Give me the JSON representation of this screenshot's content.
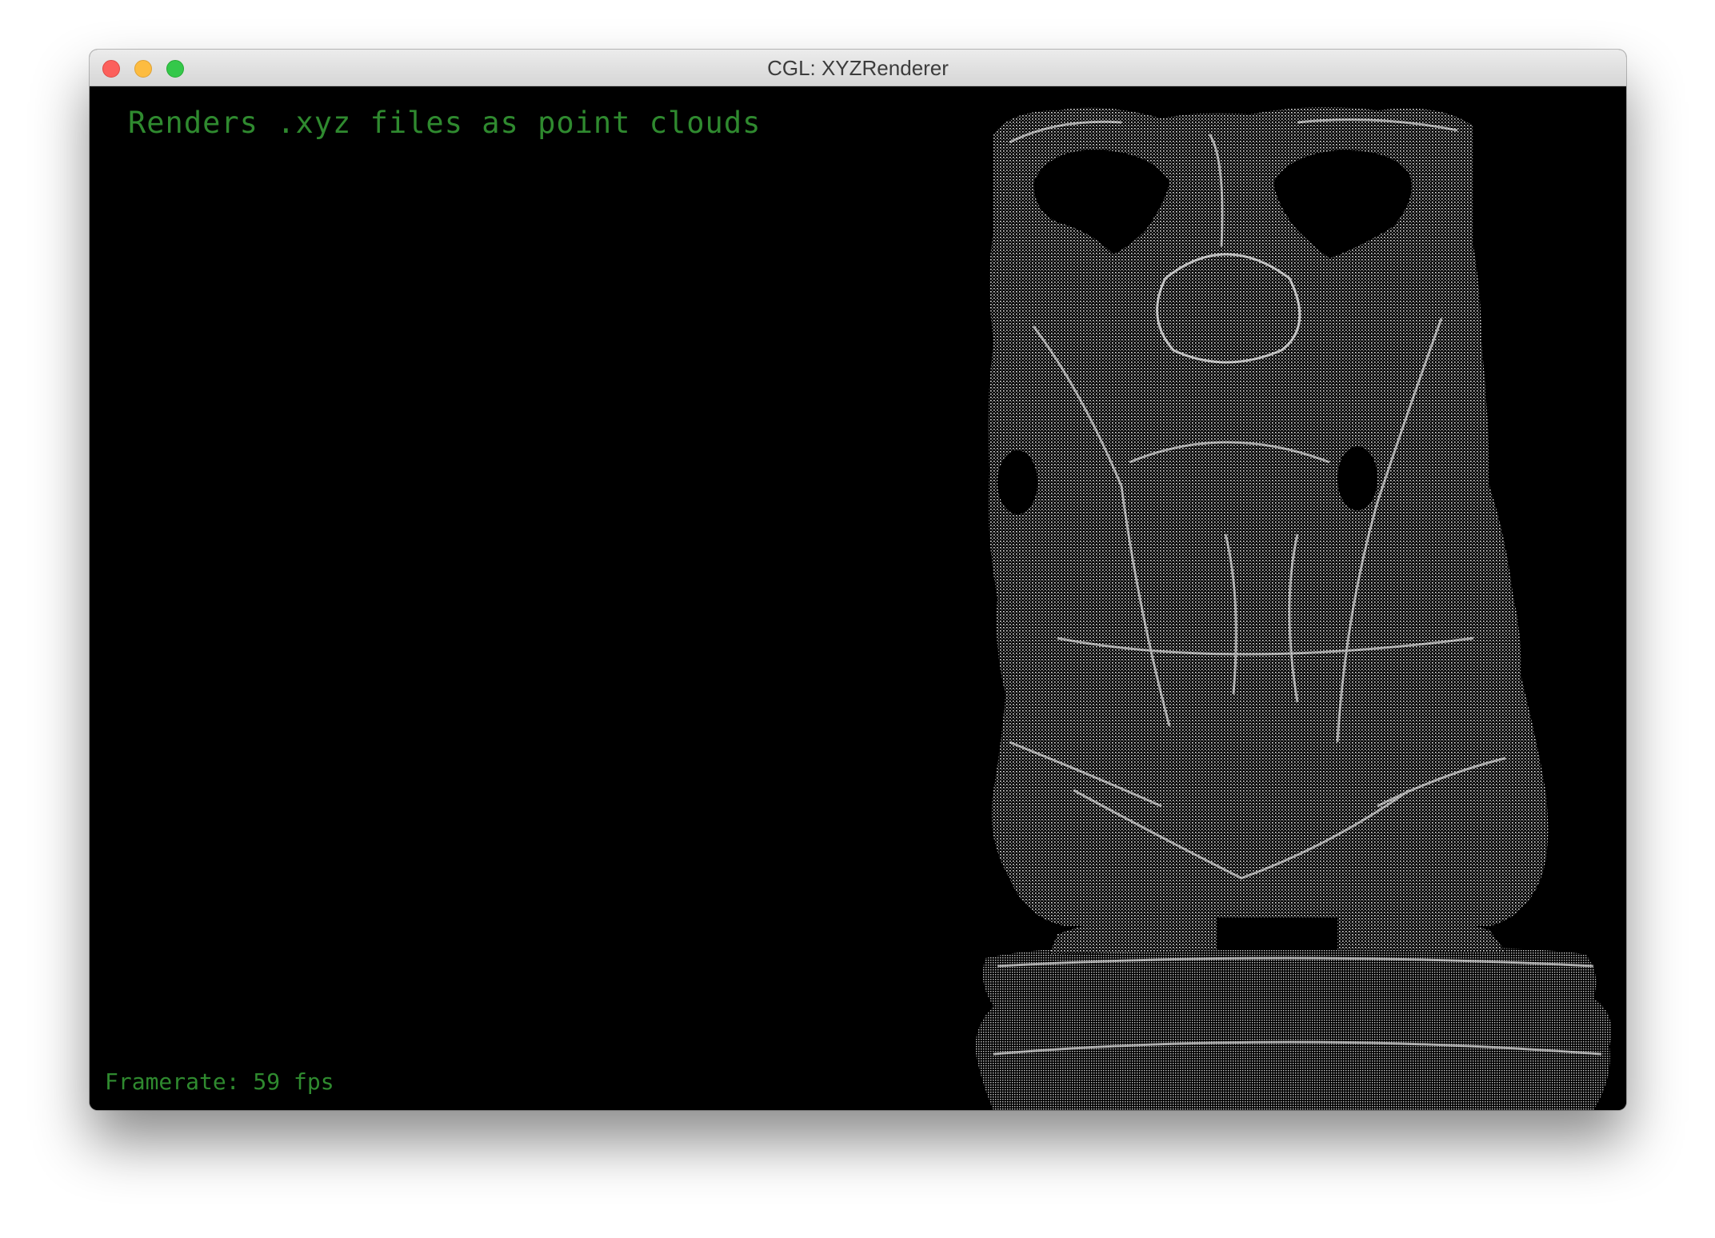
{
  "window": {
    "title": "CGL: XYZRenderer",
    "controls": {
      "close": "close-button",
      "minimize": "minimize-button",
      "zoom": "zoom-button"
    },
    "colors": {
      "close": "#fc605c",
      "minimize": "#fdbc40",
      "zoom": "#34c84a"
    }
  },
  "viewport": {
    "headline": "Renders .xyz files as point clouds",
    "framerate": "Framerate: 59 fps",
    "text_color": "#2f8a2f",
    "background": "#000000",
    "point_color": "#ffffff"
  }
}
